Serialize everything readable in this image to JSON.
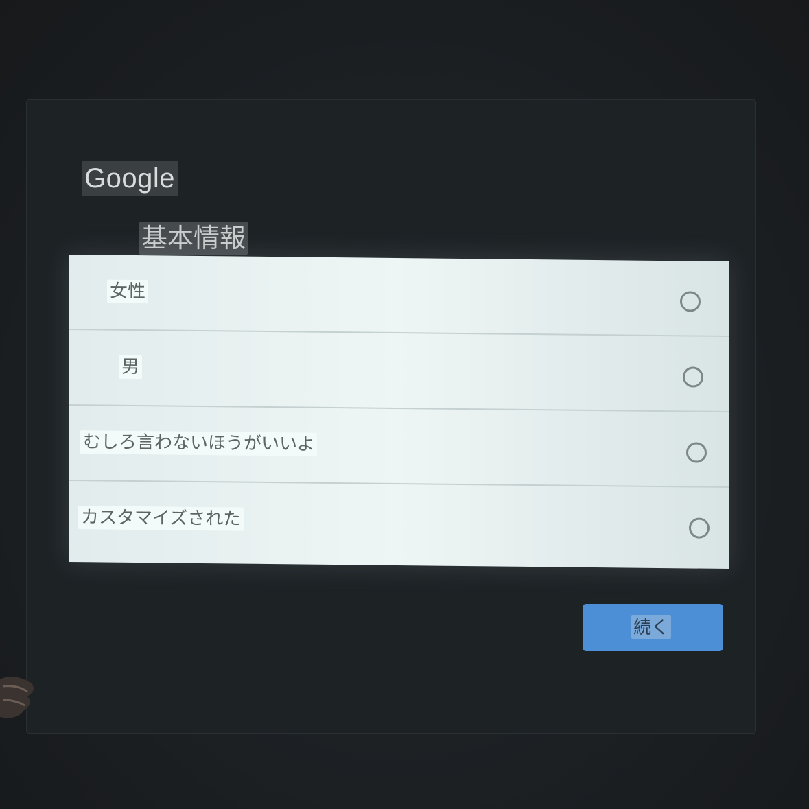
{
  "header": {
    "brand": "Google",
    "title": "基本情報"
  },
  "gender_options": [
    {
      "label": "女性",
      "selected": false
    },
    {
      "label": "男",
      "selected": false
    },
    {
      "label": "むしろ言わないほうがいいよ",
      "selected": false
    },
    {
      "label": "カスタマイズされた",
      "selected": false
    }
  ],
  "footer": {
    "continue_label": "続く"
  },
  "colors": {
    "accent": "#4d8fd6",
    "background": "#1b1e21",
    "list_background": "#e8f0f0"
  }
}
